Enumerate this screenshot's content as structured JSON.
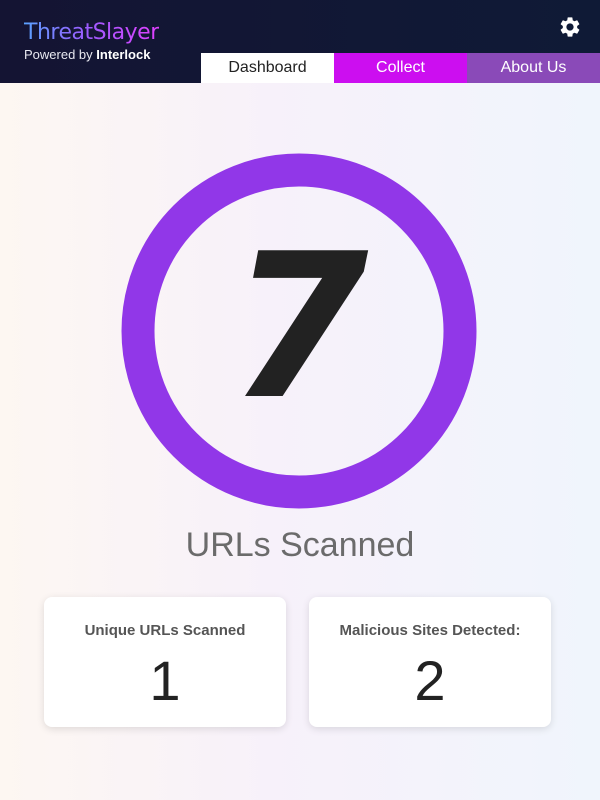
{
  "header": {
    "brand_title": "ThreatSlayer",
    "brand_powered_prefix": "Powered by ",
    "brand_powered_name": "Interlock",
    "settings_icon": "gear-icon"
  },
  "tabs": [
    {
      "label": "Dashboard",
      "active": true
    },
    {
      "label": "Collect",
      "active": false
    },
    {
      "label": "About Us",
      "active": false
    }
  ],
  "dashboard": {
    "urls_scanned_count": "7",
    "urls_scanned_label": "URLs Scanned",
    "cards": [
      {
        "title": "Unique URLs Scanned",
        "value": "1"
      },
      {
        "title": "Malicious Sites Detected:",
        "value": "2"
      }
    ]
  },
  "colors": {
    "header_bg": "#141433",
    "ring": "#9137e8",
    "tab_collect": "#cc0ef0",
    "tab_about": "#8a4ab8"
  }
}
